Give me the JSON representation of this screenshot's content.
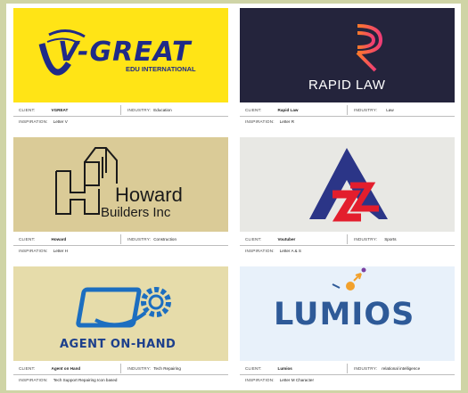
{
  "colors": {
    "frame": "#cfd4a6",
    "vgreat_bg": "#ffe416",
    "vgreat_text": "#1f2a88",
    "rapid_bg": "#24243c",
    "rapid_orange": "#ff7b29",
    "rapid_pink": "#ef3d75",
    "howard_bg": "#dacb97",
    "voutuber_bg": "#e8e8e4",
    "agent_bg": "#e6dcaa",
    "agent_blue": "#1c6ec0",
    "lumios_bg": "#e8f1fa",
    "lumios_text": "#2e5a98"
  },
  "labels": {
    "client": "CLIENT:",
    "industry": "INDUSTRY:",
    "inspiration": "INSPIRATION:"
  },
  "cards": [
    {
      "logo_title": "V-GREAT",
      "logo_sub": "EDU INTERNATIONAL",
      "client": "VGREAT",
      "industry": "Education",
      "inspiration": "Letter V"
    },
    {
      "logo_title": "RAPID LAW",
      "client": "Rapid Law",
      "industry": "Law",
      "inspiration": "Letter R"
    },
    {
      "logo_title": "Howard",
      "logo_sub": "Builders Inc",
      "client": "Howard",
      "industry": "Construction",
      "inspiration": "Letter H"
    },
    {
      "client": "Voutuber",
      "industry": "Sports",
      "inspiration": "Letter A & S"
    },
    {
      "logo_title": "AGENT ON-HAND",
      "client": "Agent on Hand",
      "industry": "Tech Repairing",
      "inspiration": "Tech Support Repairing Icon based"
    },
    {
      "logo_title": "LUMIOS",
      "client": "Lumios",
      "industry": "relational intelligence",
      "inspiration": "Letter M Character"
    }
  ]
}
